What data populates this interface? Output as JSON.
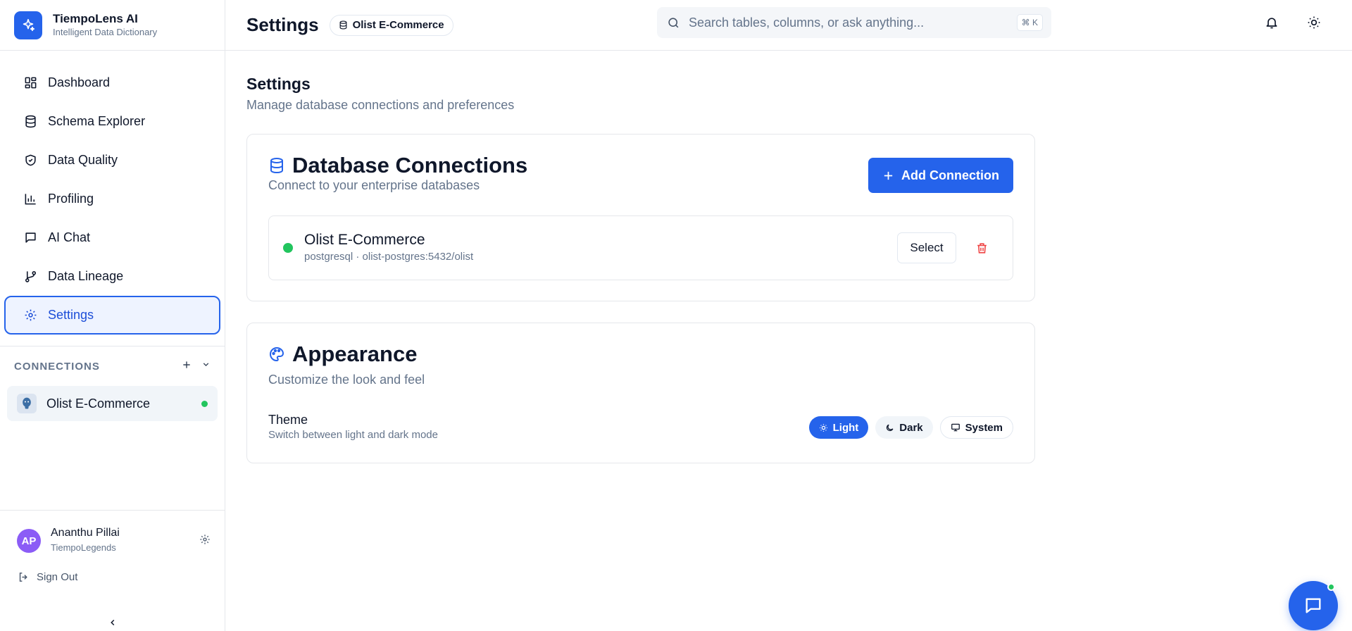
{
  "brand": {
    "name": "TiempoLens AI",
    "subtitle": "Intelligent Data Dictionary",
    "icon": "sparkles-icon"
  },
  "nav": [
    {
      "label": "Dashboard",
      "icon": "dashboard-icon",
      "active": false
    },
    {
      "label": "Schema Explorer",
      "icon": "database-icon",
      "active": false
    },
    {
      "label": "Data Quality",
      "icon": "shield-check-icon",
      "active": false
    },
    {
      "label": "Profiling",
      "icon": "bar-chart-icon",
      "active": false
    },
    {
      "label": "AI Chat",
      "icon": "message-icon",
      "active": false
    },
    {
      "label": "Data Lineage",
      "icon": "git-branch-icon",
      "active": false
    },
    {
      "label": "Settings",
      "icon": "gear-icon",
      "active": true
    }
  ],
  "connections": {
    "title": "CONNECTIONS",
    "items": [
      {
        "name": "Olist E-Commerce",
        "status": "connected",
        "icon": "postgres-icon"
      }
    ]
  },
  "user": {
    "initials": "AP",
    "name": "Ananthu Pillai",
    "org": "TiempoLegends"
  },
  "signout_label": "Sign Out",
  "header": {
    "title": "Settings",
    "db_chip": "Olist E-Commerce",
    "search_placeholder": "Search tables, columns, or ask anything...",
    "shortcut": "⌘ K"
  },
  "page": {
    "title": "Settings",
    "subtitle": "Manage database connections and preferences"
  },
  "db_card": {
    "title": "Database Connections",
    "subtitle": "Connect to your enterprise databases",
    "add_label": "Add Connection",
    "connection": {
      "name": "Olist E-Commerce",
      "detail": "postgresql · olist-postgres:5432/olist",
      "select_label": "Select"
    }
  },
  "appearance": {
    "title": "Appearance",
    "subtitle": "Customize the look and feel",
    "theme_label": "Theme",
    "theme_sub": "Switch between light and dark mode",
    "options": [
      "Light",
      "Dark",
      "System"
    ],
    "selected": "Light"
  },
  "colors": {
    "accent": "#2563eb",
    "success": "#22c55e",
    "danger": "#ef4444",
    "avatar": "#8b5cf6"
  }
}
